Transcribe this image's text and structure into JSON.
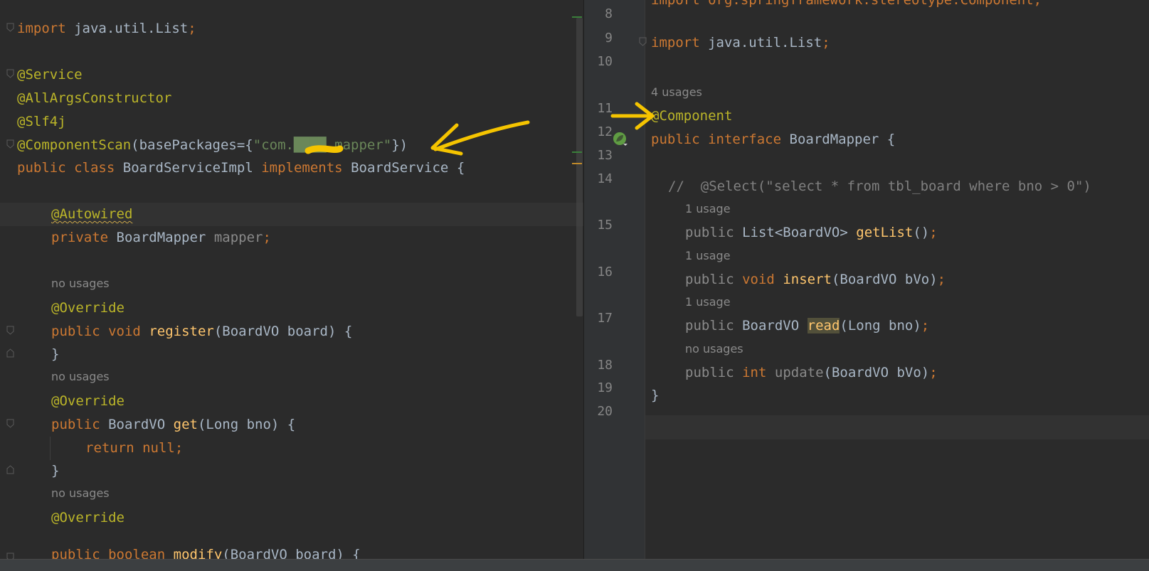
{
  "left": {
    "lines": {
      "import": {
        "kw": "import",
        "text": "java.util.List",
        "semi": ";"
      },
      "service": "@Service",
      "allargs": "@AllArgsConstructor",
      "slf4j": "@Slf4j",
      "scan": {
        "ann": "@ComponentScan",
        "open": "(basePackages={",
        "value": "\"com.████.mapper\"",
        "close": "})"
      },
      "classdecl": {
        "kw1": "public",
        "kw2": "class",
        "name": "BoardServiceImpl",
        "kw3": "implements",
        "iface": "BoardService",
        "brace": "{"
      },
      "autowired": "@Autowired",
      "field": {
        "kw": "private",
        "type": "BoardMapper",
        "name": "mapper",
        "semi": ";"
      },
      "hint1": "no usages",
      "override1": "@Override",
      "register": {
        "kw1": "public",
        "kw2": "void",
        "fn": "register",
        "args": "(BoardVO board) {"
      },
      "close1": "}",
      "hint2": "no usages",
      "override2": "@Override",
      "get": {
        "kw1": "public",
        "type": "BoardVO",
        "fn": "get",
        "args": "(Long bno) {"
      },
      "ret": {
        "kw": "return",
        "kw2": "null",
        "semi": ";"
      },
      "close2": "}",
      "hint3": "no usages",
      "override3": "@Override",
      "modify": {
        "kw1": "public",
        "kw2": "boolean",
        "fn": "modify",
        "args": "(BoardVO board) {"
      }
    }
  },
  "right": {
    "line_numbers": [
      "8",
      "9",
      "10",
      "11",
      "12",
      "13",
      "14",
      "15",
      "16",
      "17",
      "18",
      "19",
      "20"
    ],
    "lines": {
      "topcut": "import org.springframework.stereotype.Component;",
      "import": {
        "kw": "import",
        "text": "java.util.List",
        "semi": ";"
      },
      "usages4": "4 usages",
      "component": "@Component",
      "iface": {
        "kw1": "public",
        "kw2": "interface",
        "name": "BoardMapper",
        "brace": "{"
      },
      "comment": {
        "slashes": "//",
        "rest": "  @Select(\"select * from tbl_board where bno > 0\")"
      },
      "usage1a": "1 usage",
      "getlist": {
        "kw": "public",
        "type": "List<BoardVO>",
        "fn": "getList",
        "args": "()",
        "semi": ";"
      },
      "usage1b": "1 usage",
      "insert": {
        "kw": "public",
        "kw2": "void",
        "fn": "insert",
        "args": "(BoardVO bVo)",
        "semi": ";"
      },
      "usage1c": "1 usage",
      "read": {
        "kw": "public",
        "type": "BoardVO",
        "fn": "read",
        "args": "(Long bno)",
        "semi": ";"
      },
      "nousage": "no usages",
      "update": {
        "kw": "public",
        "kw2": "int",
        "fn": "update",
        "args": "(BoardVO bVo)",
        "semi": ";"
      },
      "close": "}"
    }
  },
  "icons": {
    "spring_bean": "spring-bean-gutter-icon",
    "arrow": "yellow-arrow-annotation"
  },
  "colors": {
    "keyword": "#cc7832",
    "annotation": "#bbb529",
    "string": "#6a8759",
    "method": "#ffc66d",
    "field": "#9876aa",
    "arrow": "#f5c400"
  }
}
